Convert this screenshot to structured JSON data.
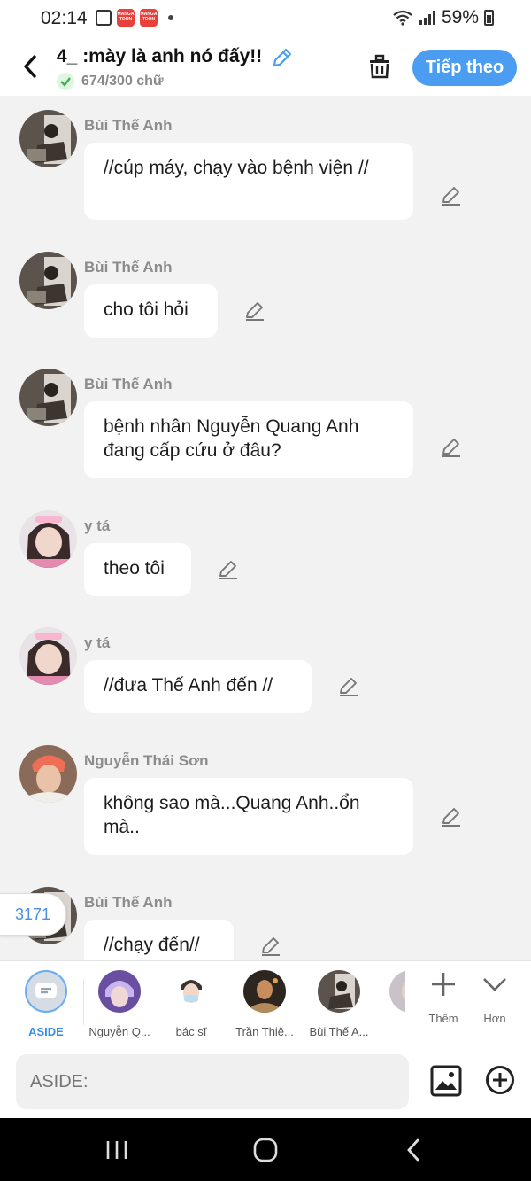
{
  "status_bar": {
    "time": "02:14",
    "battery": "59%",
    "app_icon_text": "MANGA TOON"
  },
  "header": {
    "title": "4_ :mày là anh nó đấy!!",
    "word_count": "674/300 chữ",
    "next_label": "Tiếp theo"
  },
  "messages": [
    {
      "name": "Bùi Thế Anh",
      "text": "//cúp máy, chạy vào bệnh viện //"
    },
    {
      "name": "Bùi Thế Anh",
      "text": "cho tôi hỏi"
    },
    {
      "name": "Bùi Thế Anh",
      "text": "bệnh nhân Nguyễn Quang Anh đang cấp cứu ở đâu?"
    },
    {
      "name": "y tá",
      "text": "theo tôi"
    },
    {
      "name": "y tá",
      "text": "//đưa Thế Anh đến //"
    },
    {
      "name": "Nguyễn Thái Sơn",
      "text": "không sao mà...Quang Anh..ổn mà.."
    },
    {
      "name": "Bùi Thế Anh",
      "text": "//chạy đến//"
    }
  ],
  "count_badge": "3171",
  "characters": [
    {
      "label": "ASIDE"
    },
    {
      "label": "Nguyễn Q..."
    },
    {
      "label": "bác sĩ"
    },
    {
      "label": "Trần Thiệ..."
    },
    {
      "label": "Bùi Thế A..."
    }
  ],
  "tools": {
    "add_label": "Thêm",
    "more_label": "Hơn"
  },
  "input": {
    "placeholder": "ASIDE:"
  },
  "colors": {
    "accent": "#4a9df0",
    "background": "#f2f2f2",
    "bubble": "#ffffff"
  }
}
